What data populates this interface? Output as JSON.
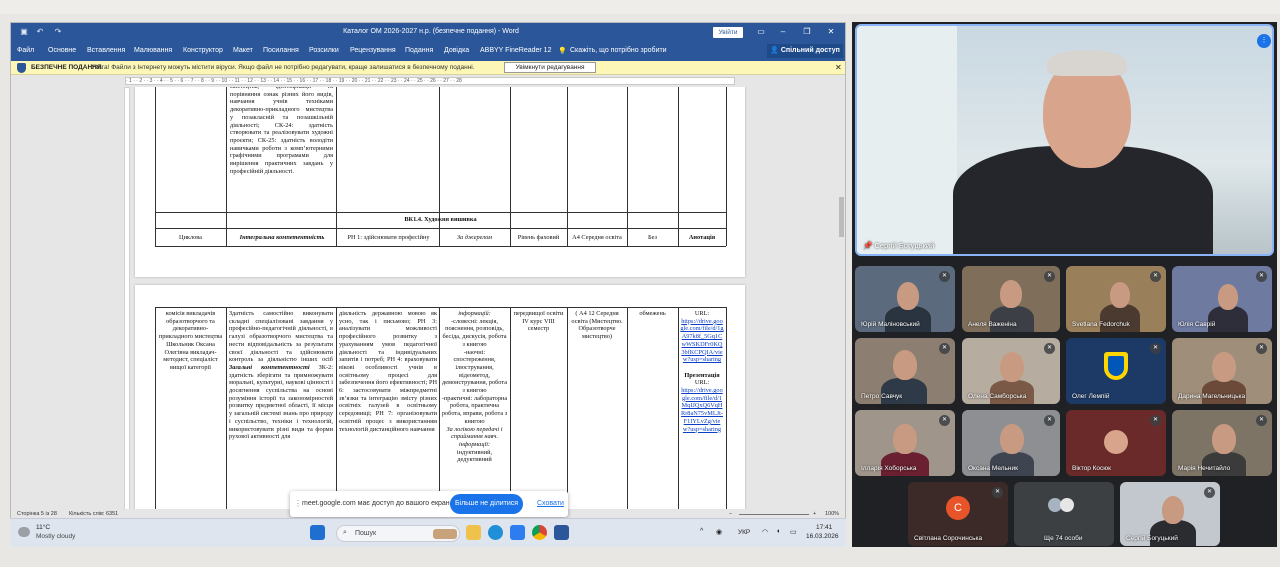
{
  "word": {
    "title": "Каталог ОМ 2026-2027 н.р. (безпечне подання) - Word",
    "login_btn": "Увійти",
    "qa_icons": [
      "save-icon",
      "undo-icon",
      "redo-icon"
    ],
    "ribbon_tabs": [
      "Файл",
      "Основне",
      "Вставлення",
      "Малювання",
      "Конструктор",
      "Макет",
      "Посилання",
      "Розсилки",
      "Рецензування",
      "Подання",
      "Довідка",
      "ABBYY FineReader 12"
    ],
    "tell_me": "Скажіть, що потрібно зробити",
    "share": "Спільний доступ",
    "protected_label": "БЕЗПЕЧНЕ ПОДАННЯ",
    "protected_msg": "Увага! Файли з Інтернету можуть містити віруси. Якщо файл не потрібно редагувати, краще залишатися в безпечному поданні.",
    "enable_edit": "Увімкнути редагування",
    "ruler_text": "· 1 · · 2 · · 3 · · 4 · · 5 · · 6 · · 7 · · 8 · · 9 · · 10 · · 11 · · 12 · · 13 · · 14 · · 15 · · 16 · · 17 · · 18 · · 19 · · 20 · · 21 · · 22 · · 23 · · 24 · · 25 · · 26 · · 27 · · 28",
    "status_page": "Сторінка 5 із 28",
    "status_words": "Кількість слів: 6351",
    "zoom": "100%"
  },
  "page1": {
    "competence_text": "мистецтва, ідентифікації та порівняння ознак різних його видів, навчання учнів техніками декоративно-прикладного мистецтва у позакласній та позашкільній діяльності; СК-24: здатність створювати та реалізовувати художні проєкти; СК-25: здатність володіти навичками роботи з комп’ютерними графічними програмами для вирішення практичних завдань у професійній діяльності.",
    "section_title": "ВК1.4. Художня вишивка",
    "row": [
      "Циклова",
      "Інтегральна компетентність",
      "РН 1: здійснювати професійну",
      "За джерелом",
      "Рівень фаховий",
      "А4 Середня освіта",
      "Без",
      "Анотація"
    ]
  },
  "page2": {
    "c1": "комісія викладачів образотворчого та декоративно-прикладного мистецтва Школьник Оксана Олегівна викладач-методист, спеціаліст вищої категорії",
    "c2a": "Здатність самостійно виконувати складні спеціалізовані завдання у професійно-педагогічній діяльності, в галузі образотворчого мистецтва та нести відповідальність за результати своєї діяльності та здійснювати контроль за діяльністю інших осіб",
    "c2h": "Загальні компетентності",
    "c2b": "ЗК-2: здатність зберігати та примножувати моральні, культурні, наукові цінності і досягнення суспільства на основі розуміння історії та закономірностей розвитку предметної області, її місця у загальній системі знань про природу і суспільство, техніки і технологій, використовувати різні види та форми рухової активності для",
    "c3": "діяльність державною мовою як усно, так і письмово; РН 3: аналізувати можливості професійного розвитку з урахуванням умов педагогічної діяльності та індивідуальних запитів і потреб; РН 4: враховувати вікові особливості учнів в освітньому процесі для забезпечення його ефективності; РН 6: застосовувати міжпредметні зв’язки та інтеграцію змісту різних освітніх галузей в освітньому середовищі; РН 7: організовувати освітній процес з використанням технологій дистанційного навчання",
    "c4a": "інформацій:",
    "c4b": "-словесні: лекція, пояснення, розповідь, бесіда, дискусія, робота з книгою",
    "c4c": "-наочні:",
    "c4d": "спостереження, ілюстрування, відеометод, демонстрування, робота з книгою",
    "c4e": "-практичні: лабораторна робота, практична робота, вправи, робота з книгою",
    "c4f": "За логікою передачі і сприймання навч. інформації:",
    "c4g": "індуктивний, дедуктивний",
    "c5": "передвищої освіти IV курс VIII семестр",
    "c6": "( А4 12 Середня освіта (Мистецтво. Образотворче мистецтво)",
    "c7": "обмежень",
    "url_label": "URL:",
    "url1": "https://drive.google.com/file/d/1gA97k8f_5Gq1CwWSKDFr0KQ3bfKCPQIA/view?usp=sharing",
    "pres_label": "Презентація",
    "url2": "https://drive.google.com/file/d/1MqIJQxQ6VqHRr8aN75vMLJt-F1IYLvZg/view?usp=sharing"
  },
  "share_bar": {
    "message": "meet.google.com має доступ до вашого екрана.",
    "stop": "Більше не ділитися",
    "hide": "Сховати"
  },
  "taskbar": {
    "temp": "11°C",
    "weather": "Mostly cloudy",
    "search": "Пошук",
    "lang": "УКР",
    "time": "17:41",
    "date": "16.03.2026"
  },
  "meet": {
    "main_speaker": "Сергій Богуцький",
    "tiles": [
      {
        "name": "Юрій Маліновський"
      },
      {
        "name": "Анеля Важеніна"
      },
      {
        "name": "Svetlana Fedorchuk"
      },
      {
        "name": "Юлія Саврій"
      },
      {
        "name": "Петро Савчук"
      },
      {
        "name": "Олена Самборська"
      },
      {
        "name": "Олег Лемпій"
      },
      {
        "name": "Дарина Магельницька"
      },
      {
        "name": "Ілларія Хоборська"
      },
      {
        "name": "Оксана Мельник"
      },
      {
        "name": "Віктор Косюк"
      },
      {
        "name": "Марія Нечитайло"
      },
      {
        "name": "Світлана Сорочинська",
        "initial": "С"
      },
      {
        "name": "Ще 74 особи"
      },
      {
        "name": "Сергій Богуцький"
      }
    ],
    "colors": {
      "accent": "#1a73e8",
      "avatar_orange": "#e8542a",
      "bg": "#202124"
    }
  }
}
